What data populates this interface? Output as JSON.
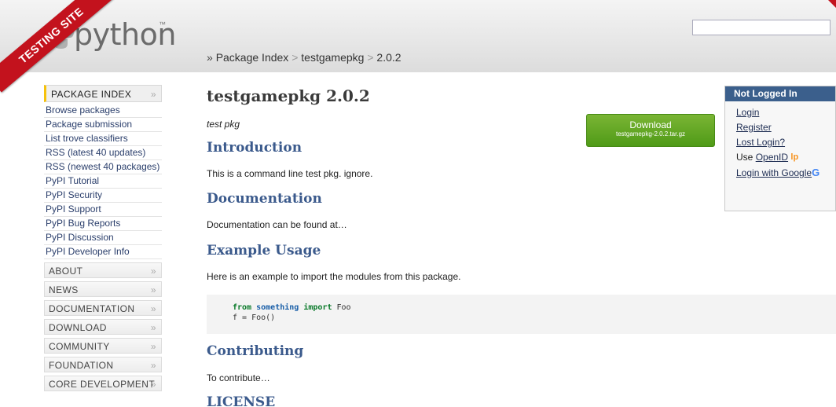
{
  "header": {
    "banner": "TESTING SITE",
    "logo_text": "python",
    "logo_tm": "™",
    "search_value": ""
  },
  "breadcrumb": {
    "prefix": "»",
    "items": [
      "Package Index",
      "testgamepkg",
      "2.0.2"
    ],
    "separator": ">"
  },
  "sidebar": {
    "active_section": "PACKAGE INDEX",
    "links": [
      "Browse packages",
      "Package submission",
      "List trove classifiers",
      "RSS (latest 40 updates)",
      "RSS (newest 40 packages)",
      "PyPI Tutorial",
      "PyPI Security",
      "PyPI Support",
      "PyPI Bug Reports",
      "PyPI Discussion",
      "PyPI Developer Info"
    ],
    "sections": [
      "ABOUT",
      "NEWS",
      "DOCUMENTATION",
      "DOWNLOAD",
      "COMMUNITY",
      "FOUNDATION",
      "CORE DEVELOPMENT"
    ],
    "chevron": "»"
  },
  "main": {
    "title": "testgamepkg 2.0.2",
    "summary": "test pkg",
    "sections": [
      {
        "heading": "Introduction",
        "text": "This is a command line test pkg. ignore."
      },
      {
        "heading": "Documentation",
        "text": "Documentation can be found at…"
      },
      {
        "heading": "Example Usage",
        "text": "Here is an example to import the modules from this package."
      },
      {
        "heading": "Contributing",
        "text": "To contribute…"
      },
      {
        "heading": "LICENSE",
        "text": ""
      }
    ],
    "code": {
      "line1": {
        "kw1": "from",
        "module": "something",
        "kw2": "import",
        "name": "Foo"
      },
      "line2": "f = Foo()"
    }
  },
  "download": {
    "label": "Download",
    "file": "testgamepkg-2.0.2.tar.gz"
  },
  "login": {
    "heading": "Not Logged In",
    "login": "Login",
    "register": "Register",
    "lost_login": "Lost Login?",
    "use_prefix": "Use",
    "openid": "OpenID",
    "openid_mark": "lp",
    "google": "Login with Google",
    "google_mark": "G"
  },
  "colors": {
    "accent": "#3b5a8c",
    "banner": "#c3121d",
    "download": "#5aa21f"
  }
}
